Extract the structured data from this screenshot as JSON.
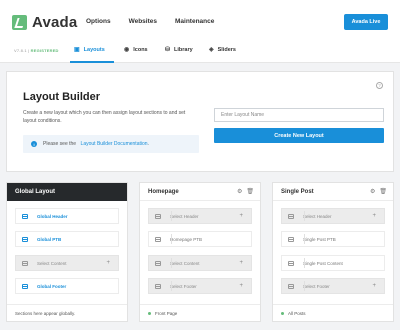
{
  "brand": {
    "name": "Avada",
    "accent": "#198fd9",
    "logo_color": "#65bc7b"
  },
  "topnav": {
    "items": [
      "Options",
      "Websites",
      "Maintenance"
    ],
    "live_button": "Avada Live"
  },
  "subnav": {
    "version": "V7.8.1",
    "separator": " | ",
    "status": "REGISTERED",
    "tabs": [
      {
        "label": "Layouts",
        "icon": "layouts-icon",
        "active": true
      },
      {
        "label": "Icons",
        "icon": "icons-icon",
        "active": false
      },
      {
        "label": "Library",
        "icon": "library-icon",
        "active": false
      },
      {
        "label": "Sliders",
        "icon": "sliders-icon",
        "active": false
      }
    ]
  },
  "builder": {
    "title": "Layout Builder",
    "description": "Create a new layout which you can then assign layout sections to and set layout conditions.",
    "info_prefix": "Please see the ",
    "info_link": "Layout Builder Documentation",
    "info_suffix": ".",
    "input_placeholder": "Enter Layout Name",
    "input_value": "",
    "create_button": "Create New Layout"
  },
  "cards": [
    {
      "title": "Global Layout",
      "slots": [
        "Global Header",
        "Global PTB",
        "Select Content",
        "Global Footer"
      ],
      "footer": "Sections here appear globally."
    },
    {
      "title": "Homepage",
      "slots": [
        "Select Header",
        "Homepage PTB",
        "Select Content",
        "Select Footer"
      ],
      "footer": "Front Page"
    },
    {
      "title": "Single Post",
      "slots": [
        "Select Header",
        "Single Post PTB",
        "Single Post Content",
        "Select Footer"
      ],
      "footer": "All Posts"
    }
  ]
}
